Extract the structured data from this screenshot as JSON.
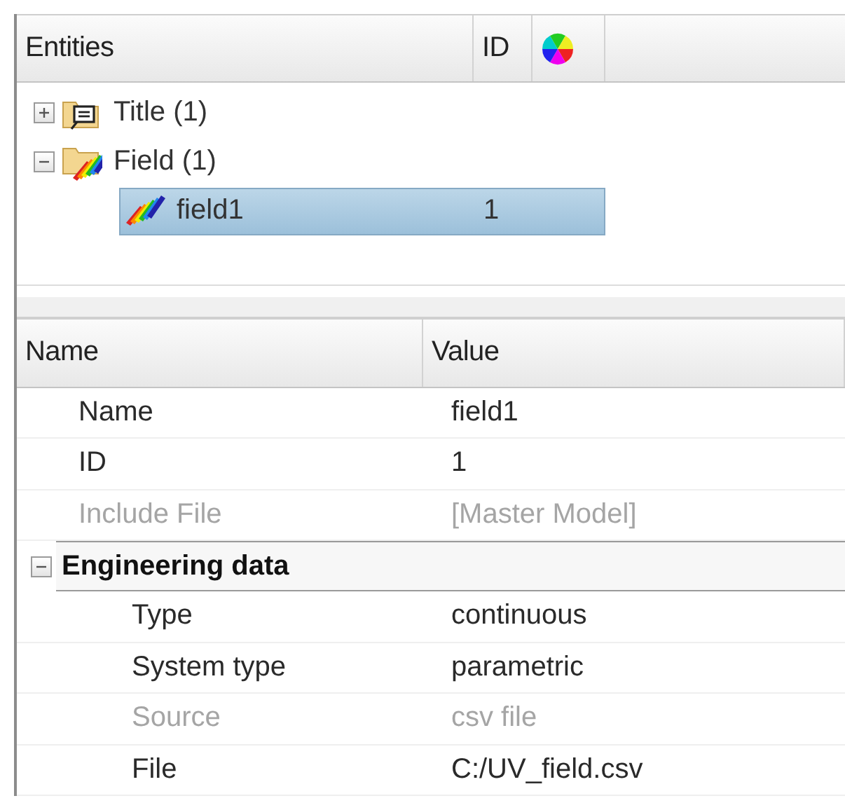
{
  "entities_panel": {
    "columns": [
      "Entities",
      "ID"
    ],
    "tree": [
      {
        "label": "Title (1)",
        "kind": "title",
        "expanded": false,
        "selected": false
      },
      {
        "label": "Field (1)",
        "kind": "field",
        "expanded": true,
        "selected": false,
        "children": [
          {
            "label": "field1",
            "id": "1",
            "kind": "field_item",
            "selected": true
          }
        ]
      }
    ]
  },
  "properties_panel": {
    "columns": [
      "Name",
      "Value"
    ],
    "rows": [
      {
        "name": "Name",
        "value": "field1",
        "disabled": false
      },
      {
        "name": "ID",
        "value": "1",
        "disabled": false
      },
      {
        "name": "Include File",
        "value": "[Master Model]",
        "disabled": true
      }
    ],
    "groups": [
      {
        "label": "Engineering data",
        "expanded": true,
        "rows": [
          {
            "name": "Type",
            "value": "continuous",
            "disabled": false
          },
          {
            "name": "System type",
            "value": "parametric",
            "disabled": false
          },
          {
            "name": "Source",
            "value": "csv file",
            "disabled": true
          },
          {
            "name": "File",
            "value": "C:/UV_field.csv",
            "disabled": false
          }
        ]
      }
    ]
  }
}
